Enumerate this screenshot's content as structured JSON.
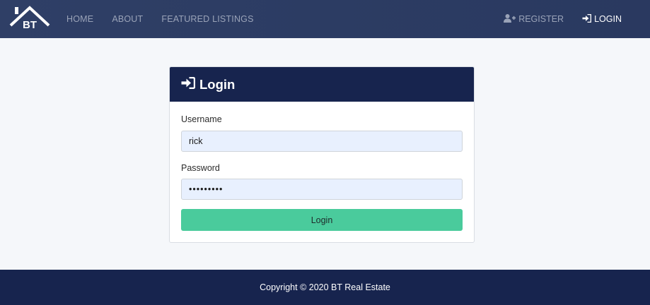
{
  "brand": {
    "logo_text": "BT"
  },
  "nav": {
    "links": [
      "HOME",
      "ABOUT",
      "FEATURED LISTINGS"
    ],
    "register_label": "REGISTER",
    "login_label": "LOGIN"
  },
  "login_card": {
    "title": "Login",
    "username_label": "Username",
    "username_value": "rick",
    "password_label": "Password",
    "password_value": "•••••••••",
    "submit_label": "Login"
  },
  "footer": {
    "copyright": "Copyright © 2020 BT Real Estate"
  },
  "colors": {
    "navbar": "#2f3f66",
    "card_header": "#17244e",
    "footer": "#17244e",
    "button": "#4acb9c",
    "input_bg": "#e8f0fe"
  }
}
